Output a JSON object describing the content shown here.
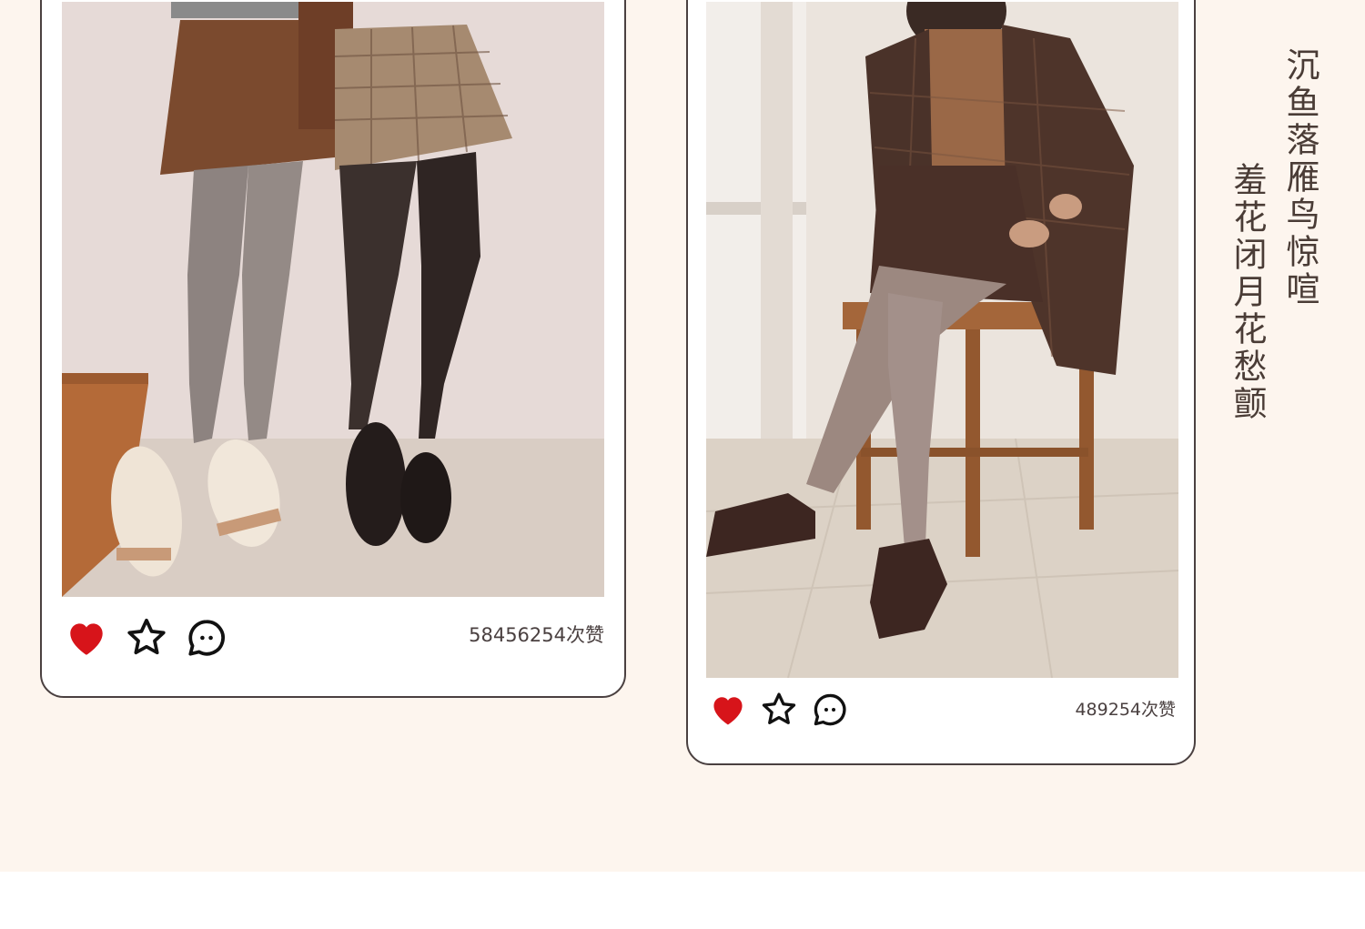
{
  "posts": [
    {
      "likes_text": "58456254次赞",
      "liked": true
    },
    {
      "likes_text": "489254次赞",
      "liked": true
    }
  ],
  "poem": {
    "line_1": "沉鱼落雁鸟惊喧",
    "line_2": "羞花闭月花愁颤"
  },
  "icons": [
    "heart-icon",
    "star-icon",
    "comment-icon"
  ],
  "colors": {
    "background": "#fdf5ee",
    "card_border": "#4a4040",
    "heart": "#d7141a",
    "text": "#4a3c36"
  }
}
